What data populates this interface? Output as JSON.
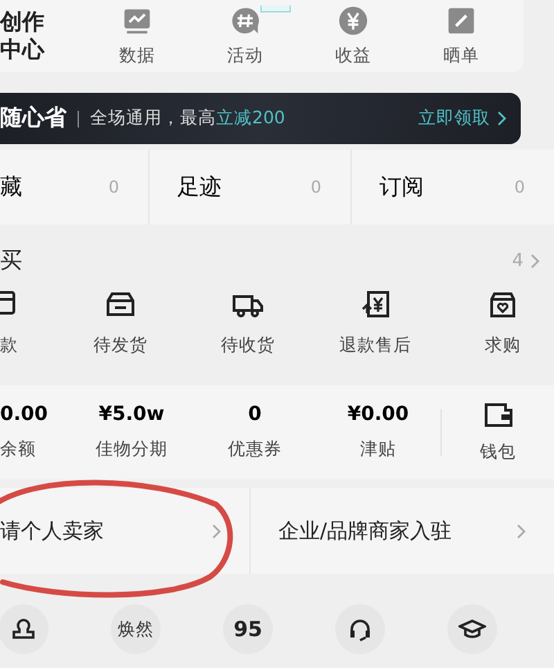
{
  "creator": {
    "title": "创作中心",
    "tools": [
      {
        "label": "数据",
        "kind": "chart",
        "has_badge": false
      },
      {
        "label": "活动",
        "kind": "hash",
        "has_badge": true
      },
      {
        "label": "收益",
        "kind": "yen",
        "has_badge": false
      },
      {
        "label": "晒单",
        "kind": "pen",
        "has_badge": false
      }
    ]
  },
  "banner": {
    "brand": "随心省",
    "text": "全场通用，最高",
    "highlight": "立减200",
    "action": "立即领取"
  },
  "counters": [
    {
      "label": "藏",
      "count": "0"
    },
    {
      "label": "足迹",
      "count": "0"
    },
    {
      "label": "订阅",
      "count": "0"
    }
  ],
  "orders": {
    "title": "买",
    "count": "4",
    "items": [
      {
        "label": "款",
        "kind": "card"
      },
      {
        "label": "待发货",
        "kind": "box"
      },
      {
        "label": "待收货",
        "kind": "truck"
      },
      {
        "label": "退款售后",
        "kind": "refund"
      },
      {
        "label": "求购",
        "kind": "bag"
      }
    ]
  },
  "wallet": {
    "items": [
      {
        "value": "0.00",
        "label": "余额"
      },
      {
        "value": "¥5.0w",
        "label": "佳物分期"
      },
      {
        "value": "0",
        "label": "优惠券"
      },
      {
        "value": "¥0.00",
        "label": "津贴"
      }
    ],
    "label": "钱包"
  },
  "seller": [
    {
      "label": "请个人卖家"
    },
    {
      "label": "企业/品牌商家入驻"
    }
  ],
  "tools": [
    {
      "kind": "stamp"
    },
    {
      "kind": "text",
      "text": "焕然"
    },
    {
      "kind": "text",
      "text": "95"
    },
    {
      "kind": "headset"
    },
    {
      "kind": "cap"
    }
  ]
}
